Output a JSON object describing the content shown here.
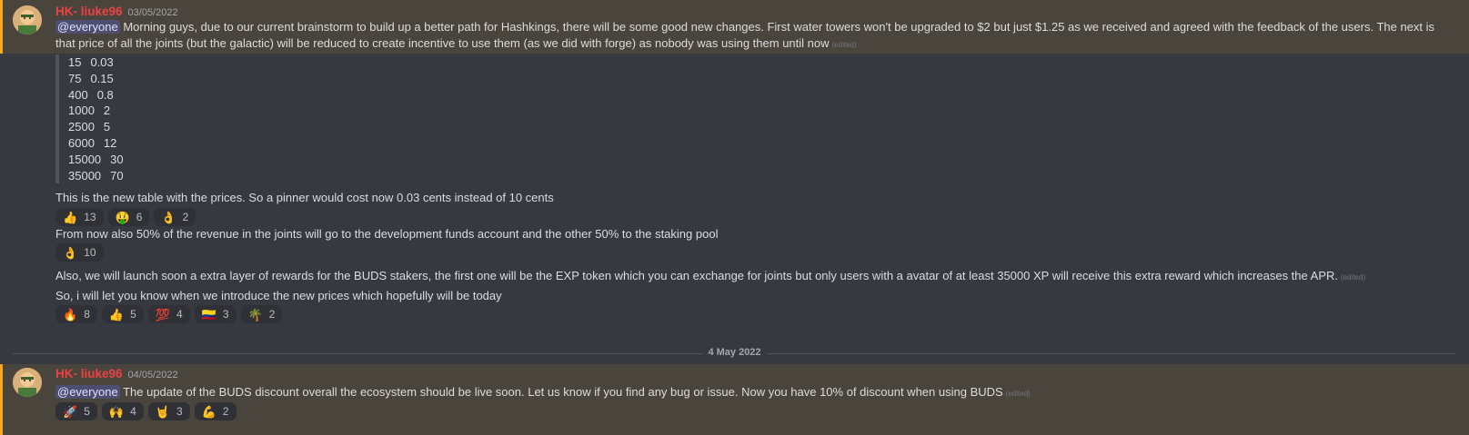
{
  "message1": {
    "author": "HK- liuke96",
    "timestamp": "03/05/2022",
    "mention": "@everyone",
    "text": "Morning guys, due to our current brainstorm to build up a better path for Hashkings, there will be some good new changes. First water towers won't be upgraded to $2 but just $1.25 as we received and agreed with the feedback of the users. The next is that price of all the joints (but the galactic) will be reduced to create incentive to use them (as we did with forge) as nobody was using them until now",
    "edited": "(edited)",
    "price_table": [
      {
        "a": "15",
        "b": "0.03"
      },
      {
        "a": "75",
        "b": "0.15"
      },
      {
        "a": "400",
        "b": "0.8"
      },
      {
        "a": "1000",
        "b": "2"
      },
      {
        "a": "2500",
        "b": "5"
      },
      {
        "a": "6000",
        "b": "12"
      },
      {
        "a": "15000",
        "b": "30"
      },
      {
        "a": "35000",
        "b": "70"
      }
    ],
    "text2": "This is the new table with the prices. So a pinner would cost now 0.03 cents instead of 10 cents",
    "reactions1": [
      {
        "emoji": "👍",
        "count": "13"
      },
      {
        "emoji": "🤑",
        "count": "6"
      },
      {
        "emoji": "👌",
        "count": "2"
      }
    ],
    "text3": "From now also 50% of the revenue in the joints will go to the development funds account and the other 50% to the staking pool",
    "reactions2": [
      {
        "emoji": "👌",
        "count": "10"
      }
    ],
    "text4": "Also, we will launch soon a extra layer of rewards for the BUDS stakers, the first one will be the EXP token which you can exchange for joints but only users with a avatar of at least 35000 XP will receive this extra reward which increases the APR.",
    "edited4": "(edited)",
    "text5": "So, i will let you know when we introduce the new prices which hopefully will be today",
    "reactions3": [
      {
        "emoji": "🔥",
        "count": "8"
      },
      {
        "emoji": "👍",
        "count": "5"
      },
      {
        "emoji": "💯",
        "count": "4"
      },
      {
        "emoji": "🇨🇴",
        "count": "3"
      },
      {
        "emoji": "🌴",
        "count": "2"
      }
    ]
  },
  "divider": {
    "label": "4 May 2022"
  },
  "message2": {
    "author": "HK- liuke96",
    "timestamp": "04/05/2022",
    "mention": "@everyone",
    "text": "The update of the BUDS discount overall the ecosystem should be live soon. Let us know if you find any bug or issue. Now you have 10% of discount  when using BUDS",
    "edited": "(edited)",
    "reactions": [
      {
        "emoji": "🚀",
        "count": "5"
      },
      {
        "emoji": "🙌",
        "count": "4"
      },
      {
        "emoji": "🤘",
        "count": "3"
      },
      {
        "emoji": "💪",
        "count": "2"
      }
    ]
  },
  "colors": {
    "background": "#36393f",
    "highlight": "#49443c",
    "highlight_bar": "#faa81a",
    "author": "#ed4245",
    "mention_bg": "#5865f2"
  }
}
